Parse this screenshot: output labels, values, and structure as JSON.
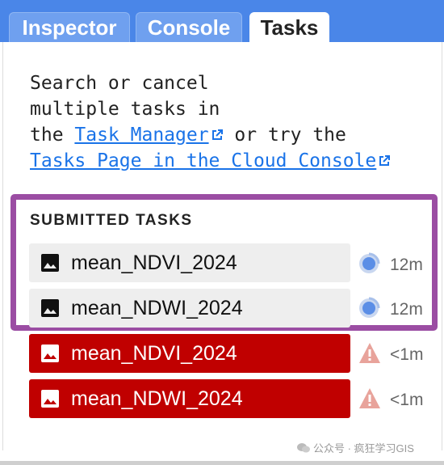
{
  "tabs": {
    "inspector": "Inspector",
    "console": "Console",
    "tasks": "Tasks"
  },
  "help": {
    "line1": "Search or cancel",
    "line2": "multiple tasks in",
    "line3_prefix": "the ",
    "task_manager_link": "Task Manager",
    "line3_suffix": " or try the",
    "tasks_page_link": "Tasks Page in the Cloud Console"
  },
  "submitted_tasks": {
    "title": "SUBMITTED TASKS",
    "items": [
      {
        "name": "mean_NDVI_2024",
        "state": "running",
        "time": "12m"
      },
      {
        "name": "mean_NDWI_2024",
        "state": "running",
        "time": "12m"
      },
      {
        "name": "mean_NDVI_2024",
        "state": "failed",
        "time": "<1m"
      },
      {
        "name": "mean_NDWI_2024",
        "state": "failed",
        "time": "<1m"
      }
    ]
  },
  "icons": {
    "task_type": "image-icon",
    "running": "spinner-globe-icon",
    "failed": "warning-triangle-icon",
    "external_link": "external-link-icon"
  },
  "colors": {
    "tab_bar": "#4a86e8",
    "link": "#1a73e8",
    "failed_task": "#c00000",
    "highlight_border": "#9b4da3",
    "warning": "#e8a39b"
  },
  "watermark": "公众号 · 疯狂学习GIS"
}
